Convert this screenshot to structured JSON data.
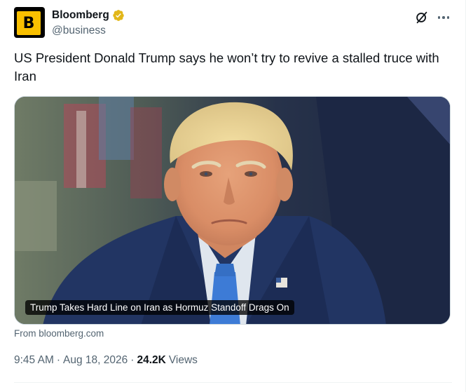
{
  "author": {
    "display_name": "Bloomberg",
    "handle": "@business",
    "avatar_letter": "B",
    "avatar_colors": {
      "background": "#000000",
      "tile": "#f9c000"
    },
    "verified_badge": "gold-verified-badge"
  },
  "header_actions": {
    "grok_icon": "grok-icon",
    "more_icon": "more-options-icon"
  },
  "tweet": {
    "text": "US President Donald Trump says he won’t try to revive a stalled truce with Iran"
  },
  "media": {
    "caption": "Trump Takes Hard Line on Iran as Hormuz Standoff Drags On",
    "source": "From bloomberg.com"
  },
  "meta": {
    "time": "9:45 AM",
    "separator": "·",
    "date": "Aug 18, 2026",
    "views_count": "24.2K",
    "views_label": "Views"
  },
  "colors": {
    "text_primary": "#0f1419",
    "text_secondary": "#536471",
    "gold_badge": "#e2b719",
    "tie_blue": "#3d7bd6"
  }
}
